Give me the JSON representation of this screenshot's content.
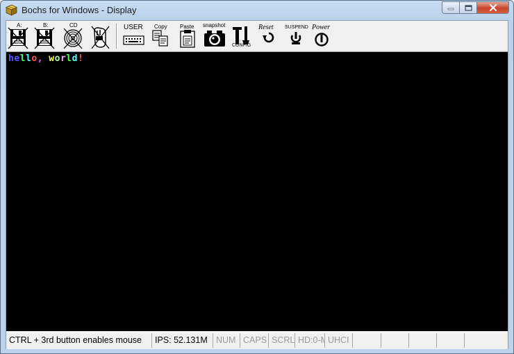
{
  "window": {
    "title": "Bochs for Windows - Display"
  },
  "toolbar": {
    "floppy_a_label": "A:",
    "floppy_b_label": "B:",
    "cdrom_label": "CD",
    "user_label": "USER",
    "copy_label": "Copy",
    "paste_label": "Paste",
    "snapshot_label": "snapshot",
    "config_label": "CONFIG",
    "reset_label": "Reset",
    "suspend_label": "SUSPEND",
    "power_label": "Power"
  },
  "screen": {
    "chars": [
      {
        "c": "h",
        "color": "#5555ff"
      },
      {
        "c": "e",
        "color": "#5555ff"
      },
      {
        "c": "l",
        "color": "#55ff55"
      },
      {
        "c": "l",
        "color": "#55ffff"
      },
      {
        "c": "o",
        "color": "#ff5555"
      },
      {
        "c": ",",
        "color": "#ff55ff"
      },
      {
        "c": " ",
        "color": "#ffffff"
      },
      {
        "c": "w",
        "color": "#ffff55"
      },
      {
        "c": "o",
        "color": "#aaffaa"
      },
      {
        "c": "r",
        "color": "#ffaaff"
      },
      {
        "c": "l",
        "color": "#55ff55"
      },
      {
        "c": "d",
        "color": "#55ffff"
      },
      {
        "c": "!",
        "color": "#ff5555"
      }
    ]
  },
  "statusbar": {
    "mouse_hint": "CTRL + 3rd button enables mouse",
    "ips": "IPS: 52.131M",
    "num": "NUM",
    "caps": "CAPS",
    "scrl": "SCRL",
    "hd": "HD:0-M",
    "uhci": "UHCI"
  },
  "colors": {
    "screen_bg": "#000000",
    "close_button": "#c7452c"
  }
}
